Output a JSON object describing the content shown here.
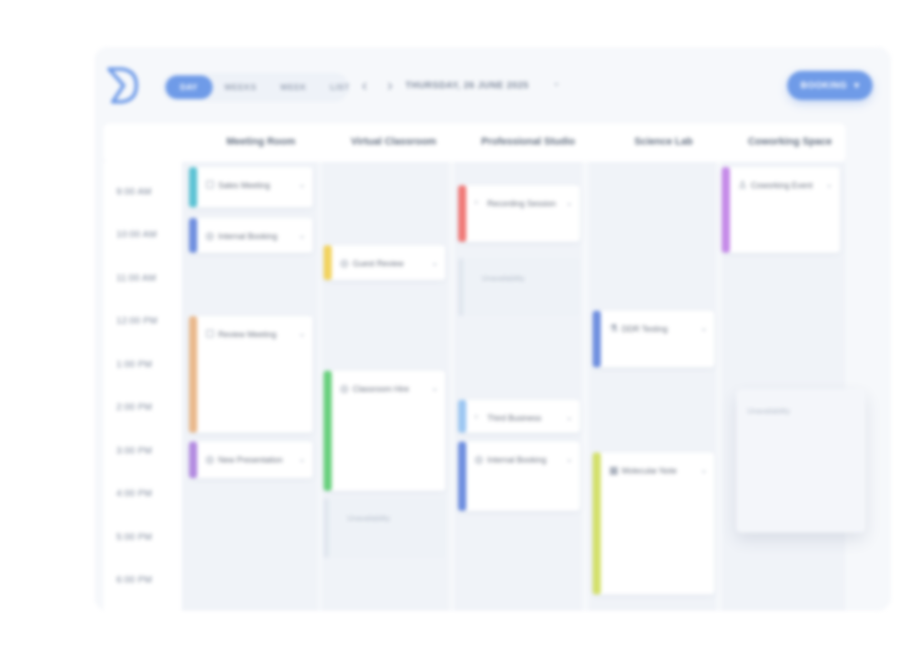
{
  "toolbar": {
    "views": [
      "DAY",
      "WEEKS",
      "WEEK",
      "LIST"
    ],
    "active_view": "DAY",
    "prev": "‹",
    "next": "›",
    "date": "THURSDAY, 26 JUNE 2025",
    "date_caret": "⌄",
    "book_label": "BOOKING",
    "book_caret": "▾"
  },
  "rooms": [
    "Meeting Room",
    "Virtual Classroom",
    "Professional Studio",
    "Science Lab",
    "Coworking Space"
  ],
  "times": [
    "9:00 AM",
    "10:00 AM",
    "11:00 AM",
    "12:00 PM",
    "1:00 PM",
    "2:00 PM",
    "3:00 PM",
    "4:00 PM",
    "5:00 PM",
    "6:00 PM"
  ],
  "events": {
    "sales_meeting": "Sales Meeting",
    "internal_booking_1": "Internal Booking",
    "review_meeting": "Review Meeting",
    "new_presentation": "New Presentation",
    "guest_review": "Guest Review",
    "classroom_hire": "Classroom Hire",
    "recording_session": "Recording Session",
    "third_business": "Third Business",
    "internal_booking_2": "Internal Booking",
    "ddr_testing": "DDR Testing",
    "molecular_note": "Molecular Note",
    "coworking_event": "Coworking Event"
  },
  "unavailable": "Unavailability",
  "colors": {
    "accent": "#6f9be8",
    "teal": "#5cc3d4",
    "blue": "#6f8fdf",
    "orange": "#eab98c",
    "purple": "#b38be0",
    "yellow": "#f2d35e",
    "green": "#69d07d",
    "red": "#f07a78",
    "lightblue": "#9dc7f2",
    "lime": "#d3e06b",
    "violet": "#c58ae8"
  }
}
